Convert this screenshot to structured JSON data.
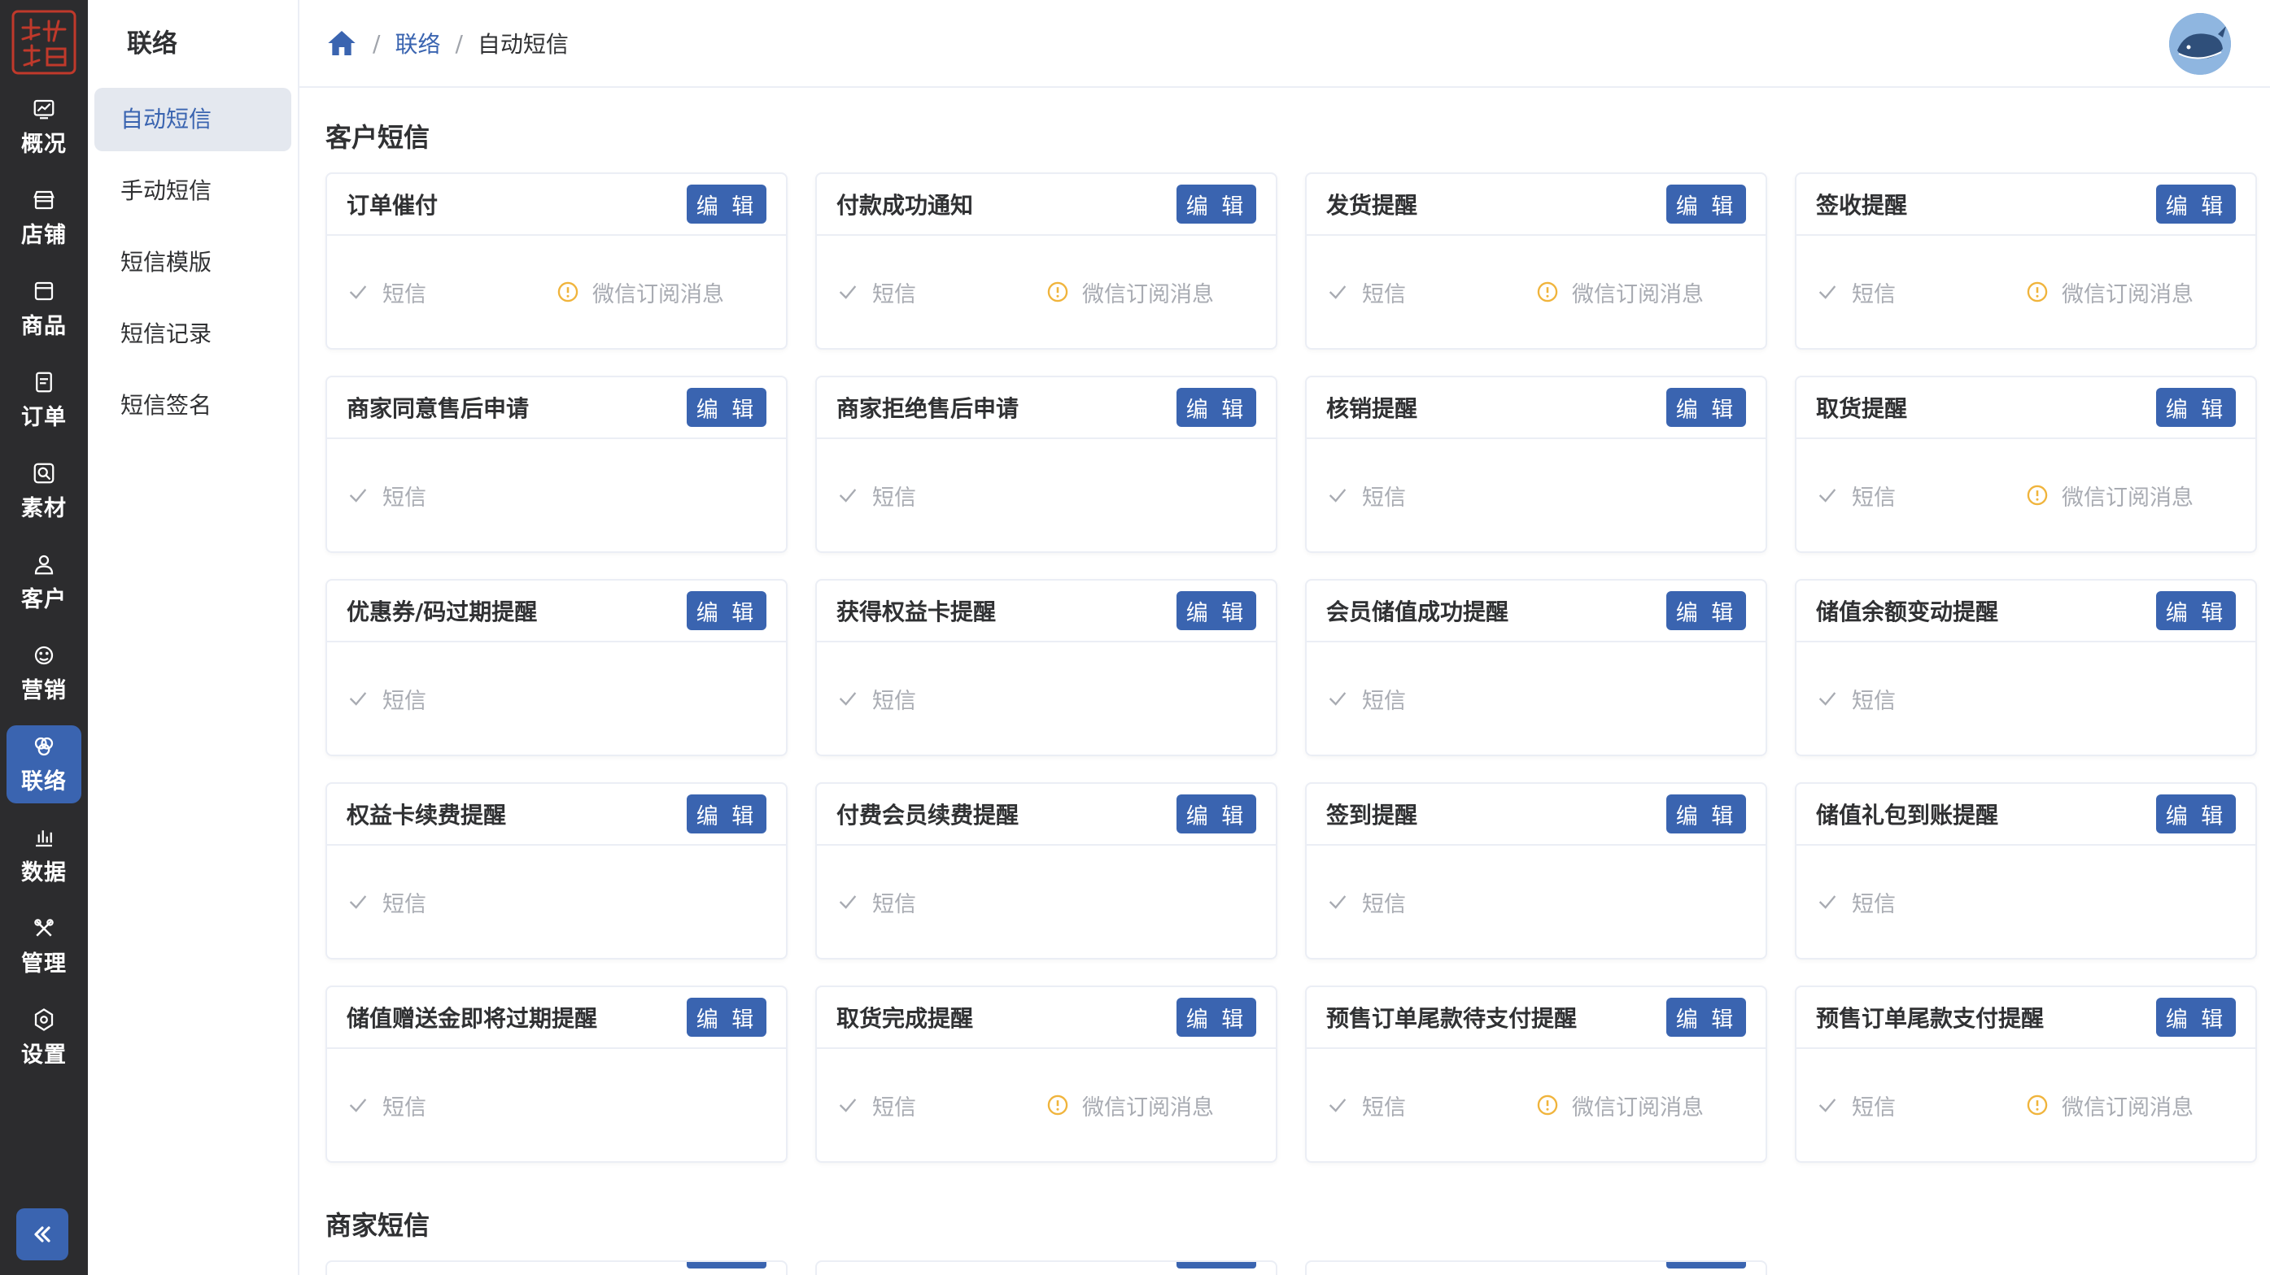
{
  "logo": {
    "icon": "brand-seal-logo"
  },
  "rail": {
    "items": [
      {
        "label": "概况",
        "icon": "overview-chart-icon",
        "active": false
      },
      {
        "label": "店铺",
        "icon": "store-icon",
        "active": false
      },
      {
        "label": "商品",
        "icon": "goods-box-icon",
        "active": false
      },
      {
        "label": "订单",
        "icon": "order-doc-icon",
        "active": false
      },
      {
        "label": "素材",
        "icon": "media-icon",
        "active": false
      },
      {
        "label": "客户",
        "icon": "user-icon",
        "active": false
      },
      {
        "label": "营销",
        "icon": "marketing-icon",
        "active": false
      },
      {
        "label": "联络",
        "icon": "contact-rings-icon",
        "active": true
      },
      {
        "label": "数据",
        "icon": "data-bars-icon",
        "active": false
      },
      {
        "label": "管理",
        "icon": "tools-icon",
        "active": false
      },
      {
        "label": "设置",
        "icon": "settings-gear-icon",
        "active": false
      }
    ],
    "collapse_icon": "double-chevron-left-icon"
  },
  "subnav": {
    "title": "联络",
    "items": [
      {
        "label": "自动短信",
        "active": true
      },
      {
        "label": "手动短信",
        "active": false
      },
      {
        "label": "短信模版",
        "active": false
      },
      {
        "label": "短信记录",
        "active": false
      },
      {
        "label": "短信签名",
        "active": false
      }
    ]
  },
  "header": {
    "breadcrumb": {
      "sep": "/",
      "link": "联络",
      "current": "自动短信"
    },
    "avatar_icon": "whale-avatar"
  },
  "sections": [
    {
      "title": "客户短信",
      "cards": [
        {
          "title": "订单催付",
          "sms": "短信",
          "wechat": "微信订阅消息"
        },
        {
          "title": "付款成功通知",
          "sms": "短信",
          "wechat": "微信订阅消息"
        },
        {
          "title": "发货提醒",
          "sms": "短信",
          "wechat": "微信订阅消息"
        },
        {
          "title": "签收提醒",
          "sms": "短信",
          "wechat": "微信订阅消息"
        },
        {
          "title": "商家同意售后申请",
          "sms": "短信",
          "wechat": ""
        },
        {
          "title": "商家拒绝售后申请",
          "sms": "短信",
          "wechat": ""
        },
        {
          "title": "核销提醒",
          "sms": "短信",
          "wechat": ""
        },
        {
          "title": "取货提醒",
          "sms": "短信",
          "wechat": "微信订阅消息"
        },
        {
          "title": "优惠券/码过期提醒",
          "sms": "短信",
          "wechat": ""
        },
        {
          "title": "获得权益卡提醒",
          "sms": "短信",
          "wechat": ""
        },
        {
          "title": "会员储值成功提醒",
          "sms": "短信",
          "wechat": ""
        },
        {
          "title": "储值余额变动提醒",
          "sms": "短信",
          "wechat": ""
        },
        {
          "title": "权益卡续费提醒",
          "sms": "短信",
          "wechat": ""
        },
        {
          "title": "付费会员续费提醒",
          "sms": "短信",
          "wechat": ""
        },
        {
          "title": "签到提醒",
          "sms": "短信",
          "wechat": ""
        },
        {
          "title": "储值礼包到账提醒",
          "sms": "短信",
          "wechat": ""
        },
        {
          "title": "储值赠送金即将过期提醒",
          "sms": "短信",
          "wechat": ""
        },
        {
          "title": "取货完成提醒",
          "sms": "短信",
          "wechat": "微信订阅消息"
        },
        {
          "title": "预售订单尾款待支付提醒",
          "sms": "短信",
          "wechat": "微信订阅消息"
        },
        {
          "title": "预售订单尾款支付提醒",
          "sms": "短信",
          "wechat": "微信订阅消息"
        }
      ]
    },
    {
      "title": "商家短信",
      "cards": []
    }
  ],
  "edit_label": "编 辑",
  "colors": {
    "primary": "#3a64b0",
    "rail_bg": "#2c2c2e",
    "sms_check": "#a8abb2",
    "wechat_warn": "#f0b43c"
  }
}
